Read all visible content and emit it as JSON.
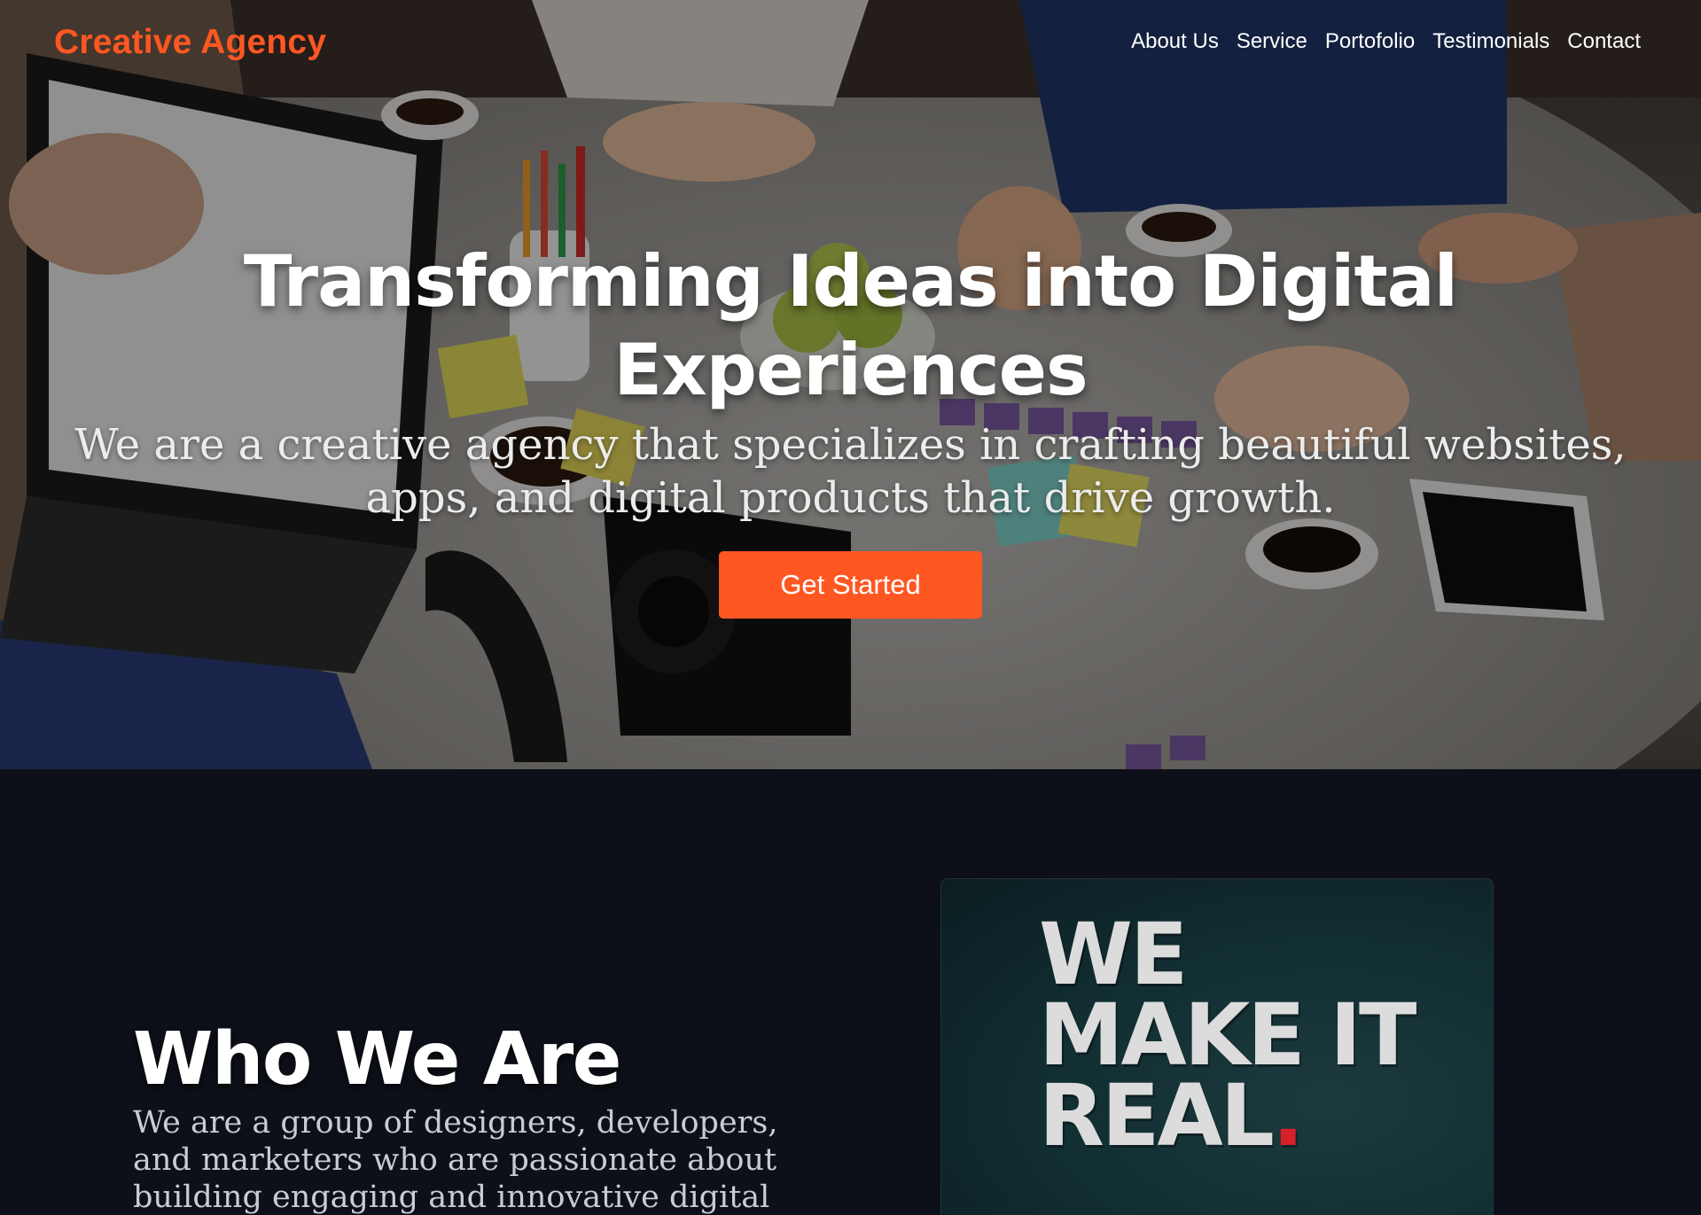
{
  "nav": {
    "logo": "Creative Agency",
    "links": [
      "About Us",
      "Service",
      "Portofolio",
      "Testimonials",
      "Contact"
    ]
  },
  "hero": {
    "title": "Transforming Ideas into Digital Experiences",
    "subtitle": "We are a creative agency that specializes in crafting beautiful websites, apps, and digital products that drive growth.",
    "cta_label": "Get Started"
  },
  "about": {
    "title": "Who We Are",
    "text": "We are a group of designers, developers, and marketers who are passionate about building engaging and innovative digital solutions. Our",
    "image_text": {
      "line1": "WE",
      "line2": "MAKE IT",
      "line3": "REAL",
      "dot": "."
    }
  },
  "colors": {
    "accent": "#ff5722",
    "background": "#0d1018",
    "dot_red": "#d6202a"
  }
}
